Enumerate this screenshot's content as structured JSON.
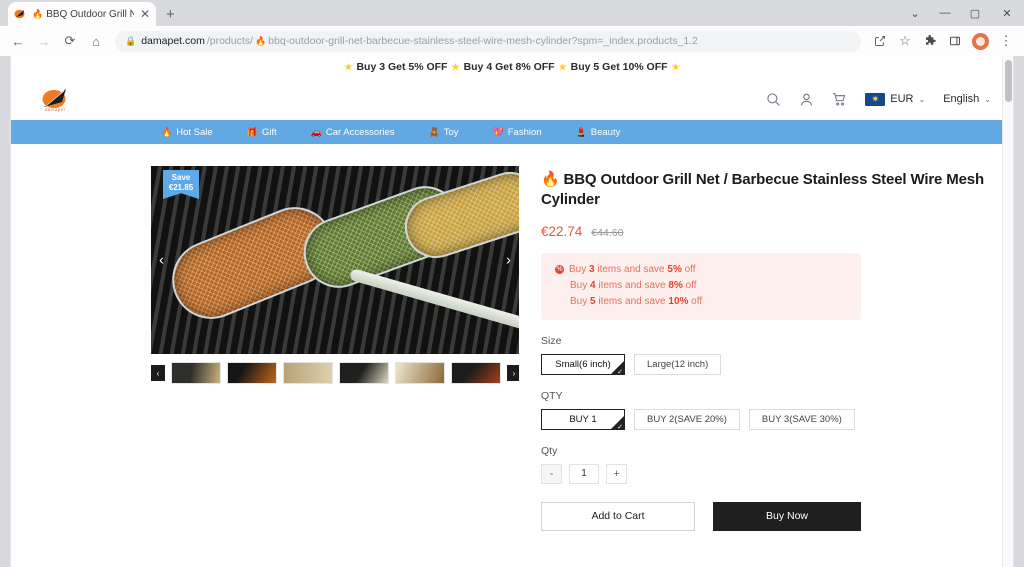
{
  "browser": {
    "tab": {
      "title": "BBQ Outdoor Grill Net / Barb",
      "favicon_icon": "flame-icon",
      "close_label": "✕"
    },
    "new_tab_label": "+",
    "window_controls": {
      "tab_search": "⌄",
      "minimize": "—",
      "maximize": "▢",
      "close": "✕"
    },
    "nav": {
      "back": "←",
      "forward": "→",
      "reload": "⟳",
      "home": "⌂"
    },
    "omnibox": {
      "lock_icon": "lock-icon",
      "url_domain": "damapet.com",
      "url_path": "/products/",
      "url_slug": "bbq-outdoor-grill-net-barbecue-stainless-steel-wire-mesh-cylinder?spm=_index.products_1.2",
      "site_icon": "flame-icon"
    },
    "toolbar_right": {
      "share": "share-icon",
      "bookmark": "☆",
      "extensions": "extensions-icon",
      "side_panel": "side-panel-icon",
      "profile": "profile-avatar",
      "menu": "⋮"
    }
  },
  "promo_banner": {
    "star": "★",
    "offers": [
      "Buy 3 Get 5% OFF",
      "Buy 4 Get 8% OFF",
      "Buy 5 Get 10% OFF"
    ]
  },
  "header": {
    "logo_text": "damapet",
    "icons": {
      "search": "search-icon",
      "account": "user-icon",
      "cart": "cart-icon"
    },
    "currency": {
      "code": "EUR",
      "flag": "eu-flag",
      "caret": "⌄"
    },
    "language": {
      "label": "English",
      "caret": "⌄"
    }
  },
  "nav_menu": [
    {
      "emoji": "🔥",
      "label": "Hot Sale",
      "icon": "flame-icon"
    },
    {
      "emoji": "🎁",
      "label": "Gift",
      "icon": "gift-icon"
    },
    {
      "emoji": "🚗",
      "label": "Car Accessories",
      "icon": "car-icon"
    },
    {
      "emoji": "🧸",
      "label": "Toy",
      "icon": "toy-icon"
    },
    {
      "emoji": "💖",
      "label": "Fashion",
      "icon": "heart-icon"
    },
    {
      "emoji": "💄",
      "label": "Beauty",
      "icon": "lipstick-icon"
    }
  ],
  "gallery": {
    "save_badge": {
      "label": "Save",
      "amount": "€21.85"
    },
    "prev_arrow": "‹",
    "next_arrow": "›",
    "thumb_prev": "‹",
    "thumb_next": "›",
    "thumbnail_count": 6
  },
  "product": {
    "title": "🔥 BBQ Outdoor Grill Net / Barbecue Stainless Steel Wire Mesh Cylinder",
    "price": "€22.74",
    "compare_at_price": "€44.60",
    "promotions": {
      "icon": "discount-badge-icon",
      "lines": [
        {
          "prefix": "Buy ",
          "qty": "3",
          "middle": " items and save ",
          "pct": "5%",
          "suffix": " off"
        },
        {
          "prefix": "Buy ",
          "qty": "4",
          "middle": " items and save ",
          "pct": "8%",
          "suffix": " off"
        },
        {
          "prefix": "Buy ",
          "qty": "5",
          "middle": " items and save ",
          "pct": "10%",
          "suffix": " off"
        }
      ]
    },
    "size": {
      "label": "Size",
      "options": [
        {
          "label": "Small(6 inch)",
          "selected": true
        },
        {
          "label": "Large(12 inch)",
          "selected": false
        }
      ]
    },
    "qty_bundle": {
      "label": "QTY",
      "options": [
        {
          "label": "BUY 1",
          "selected": true
        },
        {
          "label": "BUY 2(SAVE 20%)",
          "selected": false
        },
        {
          "label": "BUY 3(SAVE 30%)",
          "selected": false
        }
      ]
    },
    "quantity": {
      "label": "Qty",
      "decrement": "-",
      "value": "1",
      "increment": "+"
    },
    "actions": {
      "add_to_cart": "Add to Cart",
      "buy_now": "Buy Now"
    }
  },
  "colors": {
    "accent_orange": "#e8734a",
    "nav_blue": "#62a9e3",
    "price_red": "#e8563c",
    "promo_bg": "#fdf0ee",
    "buy_now_bg": "#1f1f1f",
    "badge_blue": "#5ea9e8"
  }
}
